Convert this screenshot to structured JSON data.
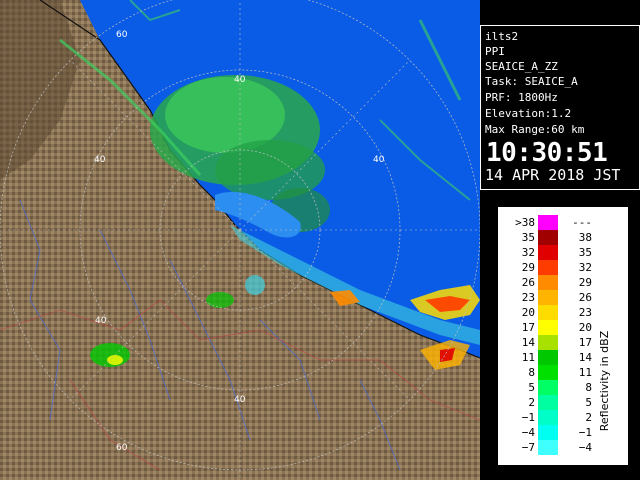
{
  "map": {
    "range_rings_km": [
      20,
      40,
      60
    ],
    "ring_labels": [
      "60",
      "40",
      "40",
      "40",
      "40",
      "60"
    ],
    "land_color": "#8b7355",
    "sea_color": "#0a5ce6",
    "ring_color": "#bfbfbf"
  },
  "info": {
    "site": "ilts2",
    "product": "PPI",
    "field": "SEAICE_A_ZZ",
    "task": "Task: SEAICE_A",
    "prf": "PRF: 1800Hz",
    "elevation": "Elevation:1.2",
    "max_range": "Max Range:60 km",
    "time": "10:30:51",
    "date": "14 APR 2018 JST"
  },
  "legend": {
    "title": "Reflectivity in dBZ",
    "rows": [
      {
        "left": ">38",
        "right": "---",
        "color": "#ff00ff"
      },
      {
        "left": "35",
        "right": "38",
        "color": "#a00000"
      },
      {
        "left": "32",
        "right": "35",
        "color": "#e00000"
      },
      {
        "left": "29",
        "right": "32",
        "color": "#ff3c00"
      },
      {
        "left": "26",
        "right": "29",
        "color": "#ff8c00"
      },
      {
        "left": "23",
        "right": "26",
        "color": "#ffb400"
      },
      {
        "left": "20",
        "right": "23",
        "color": "#ffdc00"
      },
      {
        "left": "17",
        "right": "20",
        "color": "#ffff00"
      },
      {
        "left": "14",
        "right": "17",
        "color": "#a8e000"
      },
      {
        "left": "11",
        "right": "14",
        "color": "#00c800"
      },
      {
        "left": "8",
        "right": "11",
        "color": "#00e000"
      },
      {
        "left": "5",
        "right": "8",
        "color": "#00ff64"
      },
      {
        "left": "2",
        "right": "5",
        "color": "#00ffa0"
      },
      {
        "left": "−1",
        "right": "2",
        "color": "#00ffc8"
      },
      {
        "left": "−4",
        "right": "−1",
        "color": "#00fff0"
      },
      {
        "left": "−7",
        "right": "−4",
        "color": "#40ffff"
      }
    ]
  }
}
